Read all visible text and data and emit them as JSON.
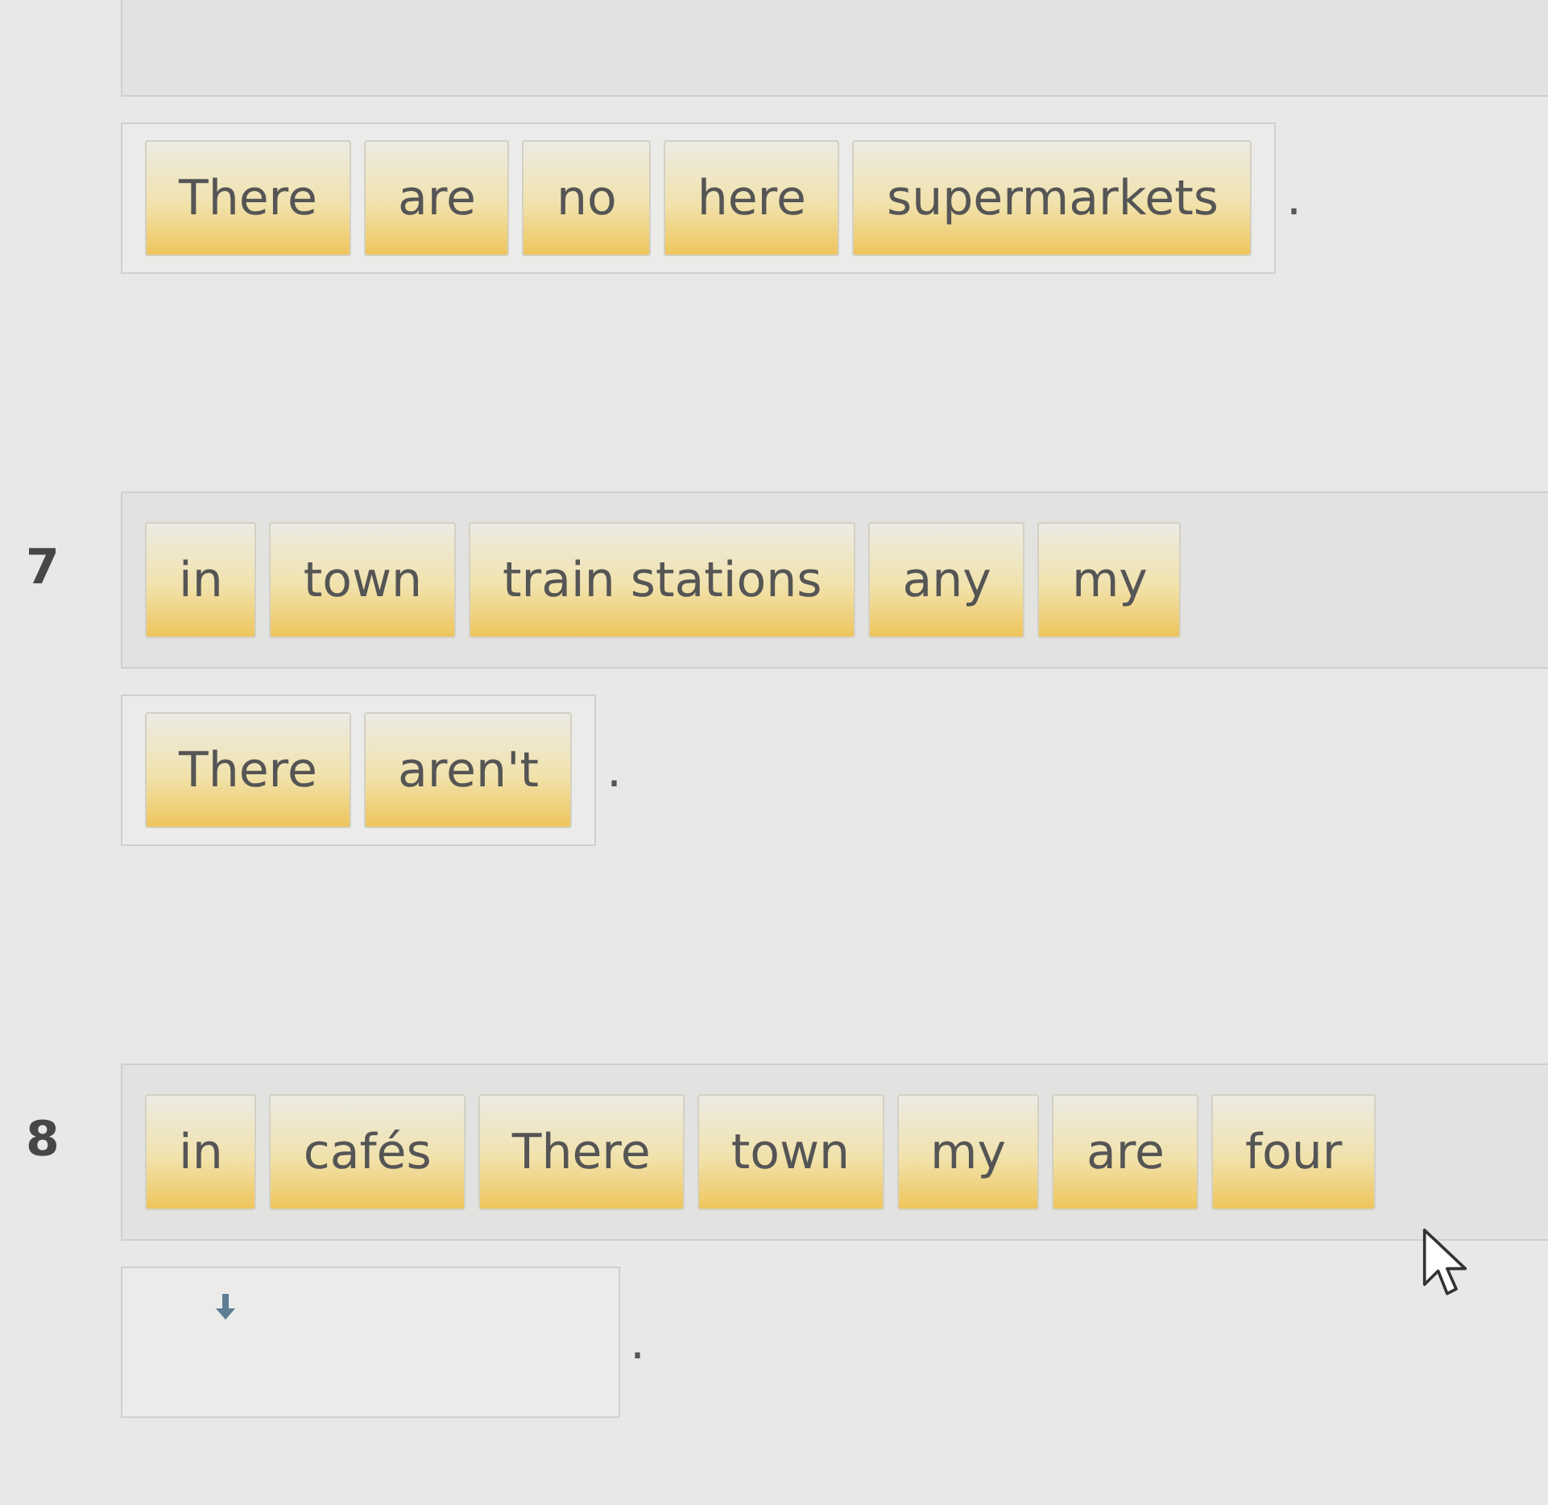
{
  "exercises": [
    {
      "answer": [
        "There",
        "are",
        "no",
        "here",
        "supermarkets"
      ],
      "end": "."
    },
    {
      "number": "7",
      "bank": [
        "in",
        "town",
        "train stations",
        "any",
        "my"
      ],
      "answer": [
        "There",
        "aren't"
      ],
      "end": "."
    },
    {
      "number": "8",
      "bank": [
        "in",
        "cafés",
        "There",
        "town",
        "my",
        "are",
        "four"
      ],
      "end": "."
    }
  ]
}
